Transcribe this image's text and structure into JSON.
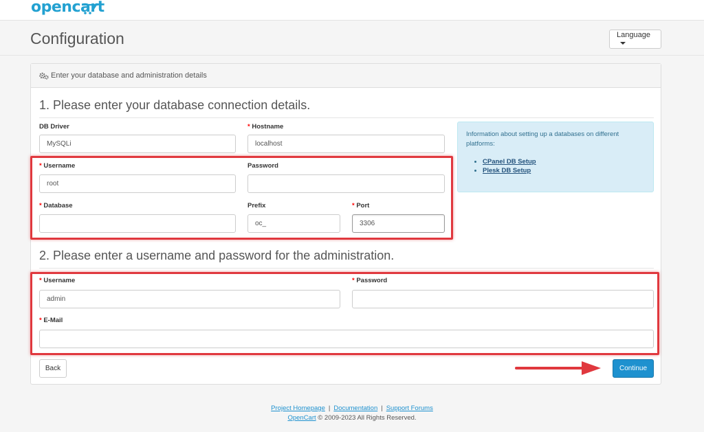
{
  "brand": {
    "logo_text": "opencart",
    "logo_color": "#23a1d1"
  },
  "header": {
    "title": "Configuration",
    "language_label": "Language"
  },
  "panel": {
    "heading": "Enter your database and administration details"
  },
  "db_section": {
    "legend": "1. Please enter your database connection details.",
    "driver": {
      "label": "DB Driver",
      "value": "MySQLi"
    },
    "hostname": {
      "label": "Hostname",
      "value": "localhost"
    },
    "username": {
      "label": "Username",
      "value": "root"
    },
    "password": {
      "label": "Password",
      "value": ""
    },
    "database": {
      "label": "Database",
      "value": ""
    },
    "prefix": {
      "label": "Prefix",
      "value": "oc_"
    },
    "port": {
      "label": "Port",
      "value": "3306"
    }
  },
  "info": {
    "text": "Information about setting up a databases on different platforms:",
    "links": [
      "CPanel DB Setup",
      "Plesk DB Setup"
    ]
  },
  "admin_section": {
    "legend": "2. Please enter a username and password for the administration.",
    "username": {
      "label": "Username",
      "value": "admin"
    },
    "password": {
      "label": "Password",
      "value": ""
    },
    "email": {
      "label": "E-Mail",
      "value": ""
    }
  },
  "actions": {
    "back_label": "Back",
    "continue_label": "Continue"
  },
  "footer": {
    "links": [
      "Project Homepage",
      "Documentation",
      "Support Forums"
    ],
    "brand_link": "OpenCart",
    "copyright": "© 2009-2023 All Rights Reserved."
  },
  "colors": {
    "accent": "#1e91cf",
    "highlight": "#e0383e",
    "required": "#ff0000",
    "info_bg": "#d9edf7"
  }
}
